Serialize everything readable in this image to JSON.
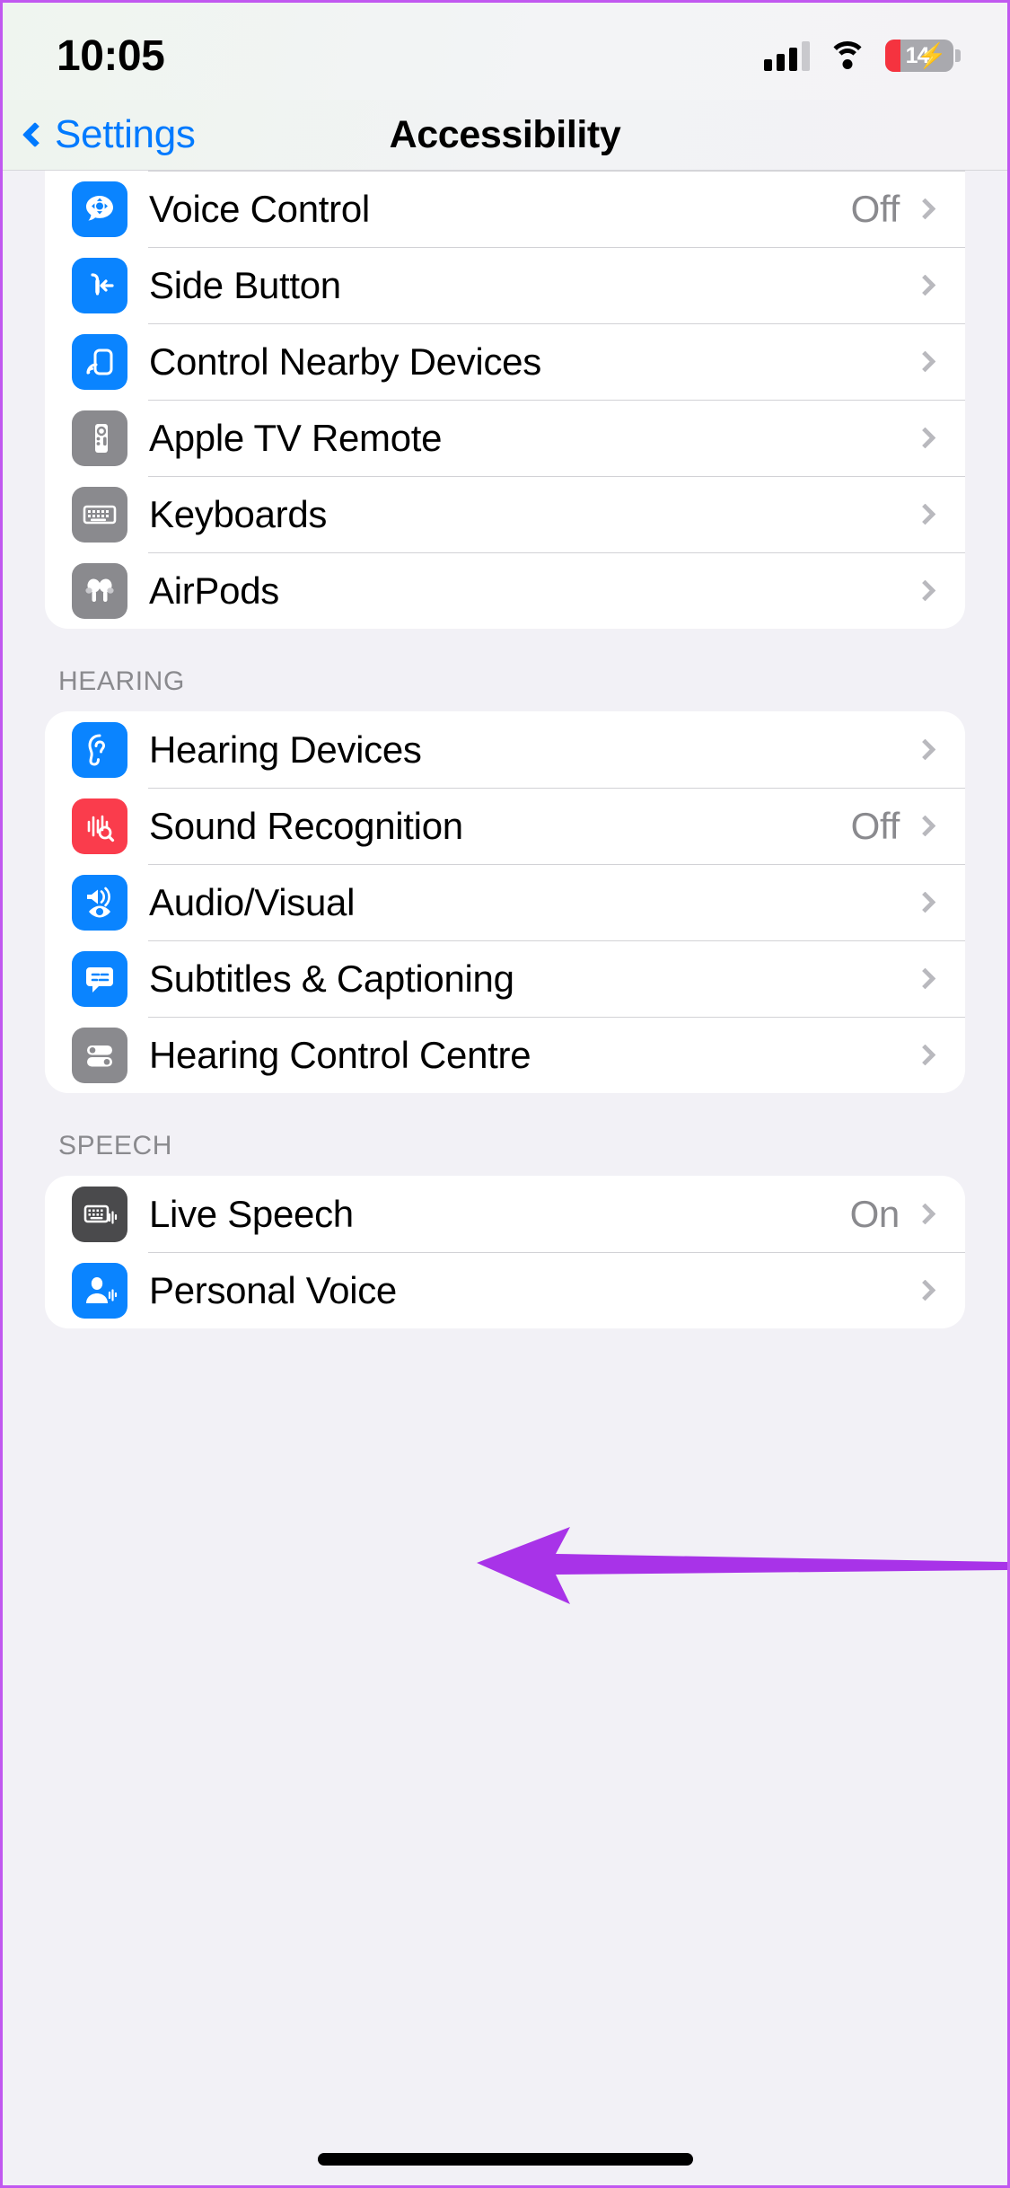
{
  "status_bar": {
    "time": "10:05",
    "battery_level": "14",
    "battery_charging": true,
    "signal_icon": "cellular-signal-icon",
    "wifi_icon": "wifi-icon",
    "battery_icon": "battery-icon"
  },
  "nav": {
    "back_label": "Settings",
    "title": "Accessibility",
    "back_icon": "chevron-left-icon"
  },
  "sections": [
    {
      "header": "",
      "rows": [
        {
          "label": "Voice Control",
          "value": "Off",
          "icon": "voice-control-icon",
          "icon_color": "#0a84ff"
        },
        {
          "label": "Side Button",
          "value": "",
          "icon": "side-button-icon",
          "icon_color": "#0a84ff"
        },
        {
          "label": "Control Nearby Devices",
          "value": "",
          "icon": "control-nearby-devices-icon",
          "icon_color": "#0a84ff"
        },
        {
          "label": "Apple TV Remote",
          "value": "",
          "icon": "apple-tv-remote-icon",
          "icon_color": "#8a8a8e"
        },
        {
          "label": "Keyboards",
          "value": "",
          "icon": "keyboard-icon",
          "icon_color": "#8a8a8e"
        },
        {
          "label": "AirPods",
          "value": "",
          "icon": "airpods-icon",
          "icon_color": "#8a8a8e"
        }
      ]
    },
    {
      "header": "HEARING",
      "rows": [
        {
          "label": "Hearing Devices",
          "value": "",
          "icon": "ear-icon",
          "icon_color": "#0a84ff"
        },
        {
          "label": "Sound Recognition",
          "value": "Off",
          "icon": "sound-recognition-icon",
          "icon_color": "#fa3c4c"
        },
        {
          "label": "Audio/Visual",
          "value": "",
          "icon": "audio-visual-icon",
          "icon_color": "#0a84ff"
        },
        {
          "label": "Subtitles & Captioning",
          "value": "",
          "icon": "subtitles-icon",
          "icon_color": "#0a84ff"
        },
        {
          "label": "Hearing Control Centre",
          "value": "",
          "icon": "hearing-control-centre-icon",
          "icon_color": "#8a8a8e"
        }
      ]
    },
    {
      "header": "SPEECH",
      "rows": [
        {
          "label": "Live Speech",
          "value": "On",
          "icon": "live-speech-icon",
          "icon_color": "#4a4a4c"
        },
        {
          "label": "Personal Voice",
          "value": "",
          "icon": "personal-voice-icon",
          "icon_color": "#0a84ff"
        }
      ]
    }
  ],
  "annotation": {
    "type": "arrow",
    "color": "#a833e8",
    "points_to": "Audio/Visual",
    "direction": "left"
  },
  "colors": {
    "accent_blue": "#007aff",
    "icon_blue": "#0a84ff",
    "icon_gray": "#8a8a8e",
    "icon_dark": "#4a4a4c",
    "icon_red": "#fa3c4c",
    "background": "#f2f1f6",
    "frame_border": "#c158f0"
  }
}
